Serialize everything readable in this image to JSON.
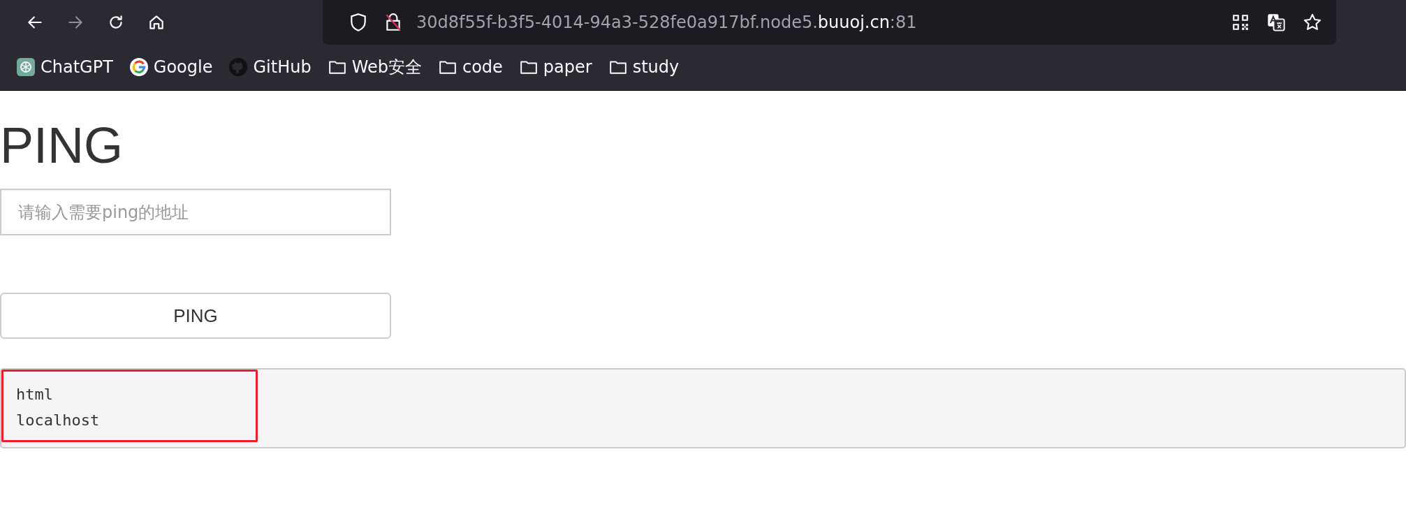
{
  "browser": {
    "nav_buttons": [
      {
        "kind": "back",
        "disabled": false
      },
      {
        "kind": "forward",
        "disabled": true
      },
      {
        "kind": "reload",
        "disabled": false
      },
      {
        "kind": "home",
        "disabled": false
      }
    ],
    "address": {
      "prefix": "30d8f55f-b3f5-4014-94a3-528fe0a917bf.node5.",
      "domain": "buuoj.cn",
      "suffix": ":81"
    },
    "bookmarks": [
      {
        "kind": "chatgpt",
        "label": "ChatGPT"
      },
      {
        "kind": "google",
        "label": "Google"
      },
      {
        "kind": "github",
        "label": "GitHub"
      },
      {
        "kind": "folder",
        "label": "Web安全"
      },
      {
        "kind": "folder",
        "label": "code"
      },
      {
        "kind": "folder",
        "label": "paper"
      },
      {
        "kind": "folder",
        "label": "study"
      }
    ]
  },
  "page": {
    "heading": "PING",
    "input": {
      "placeholder": "请输入需要ping的地址"
    },
    "button": "PING",
    "output": [
      "html",
      "localhost"
    ],
    "highlighted": true
  }
}
